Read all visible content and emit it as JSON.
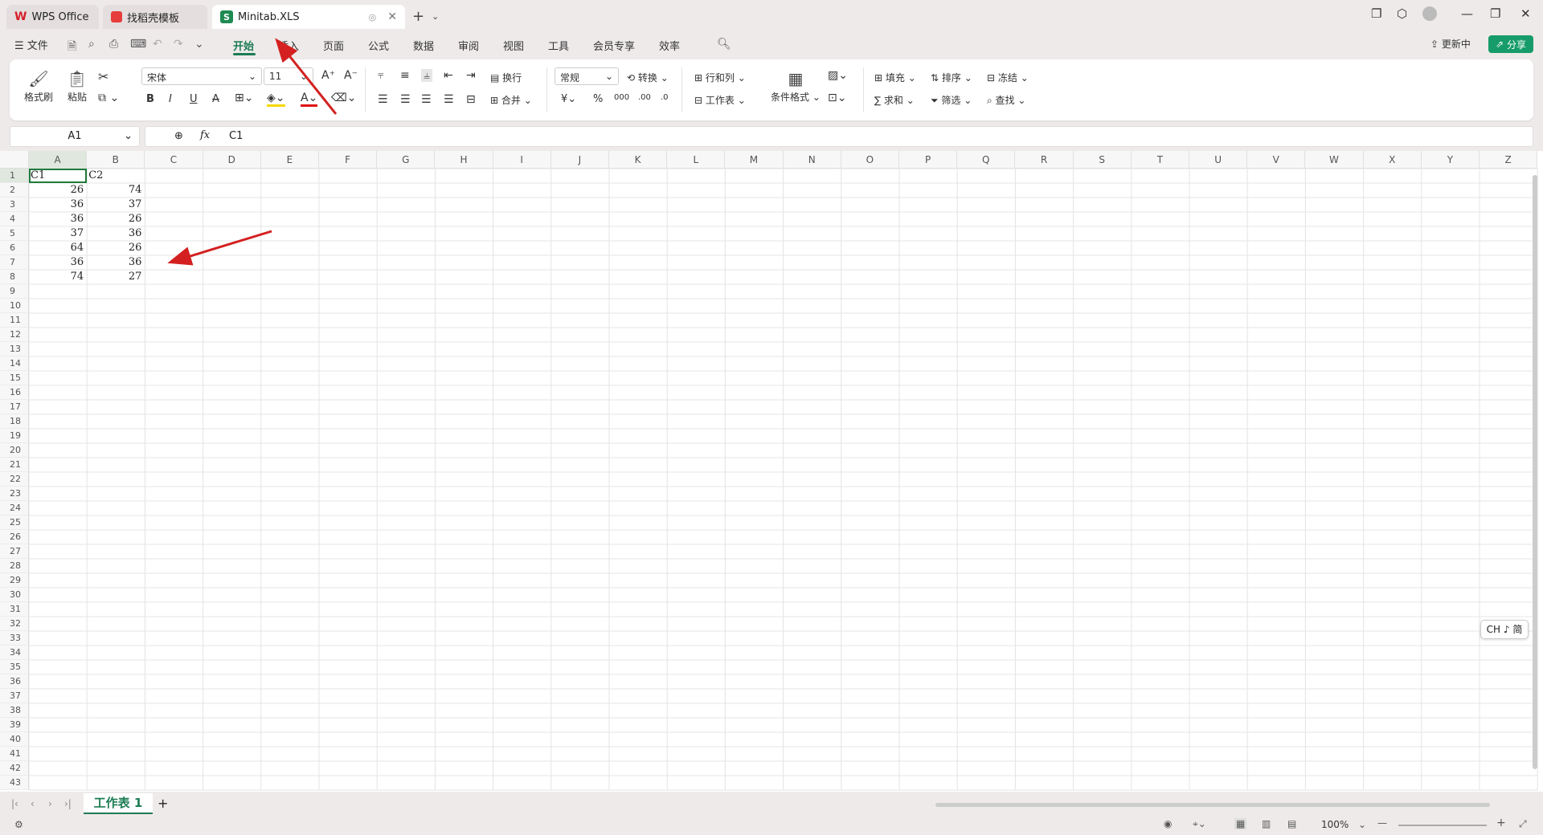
{
  "tabs": [
    {
      "label": "WPS Office"
    },
    {
      "label": "找稻壳模板"
    },
    {
      "label": "Minitab.XLS"
    }
  ],
  "menu": {
    "file": "文件",
    "items": [
      "开始",
      "插入",
      "页面",
      "公式",
      "数据",
      "审阅",
      "视图",
      "工具",
      "会员专享",
      "效率"
    ],
    "update": "更新中",
    "share": "分享"
  },
  "ribbon": {
    "format_painter": "格式刷",
    "paste": "粘贴",
    "font_name": "宋体",
    "font_size": "11",
    "wrap": "换行",
    "merge": "合并",
    "number_format": "常规",
    "convert": "转换",
    "rows_cols": "行和列",
    "worksheet": "工作表",
    "conditional": "条件格式",
    "fill": "填充",
    "sort": "排序",
    "freeze": "冻结",
    "sum": "求和",
    "filter": "筛选",
    "find": "查找"
  },
  "formula_bar": {
    "name_box": "A1",
    "fx": "fx",
    "content": "C1"
  },
  "columns": [
    "A",
    "B",
    "C",
    "D",
    "E",
    "F",
    "G",
    "H",
    "I",
    "J",
    "K",
    "L",
    "M",
    "N",
    "O",
    "P",
    "Q",
    "R",
    "S",
    "T",
    "U",
    "V",
    "W",
    "X",
    "Y",
    "Z"
  ],
  "row_count": 43,
  "cells": {
    "A": [
      "C1",
      "26",
      "36",
      "36",
      "37",
      "64",
      "36",
      "74"
    ],
    "B": [
      "C2",
      "74",
      "37",
      "26",
      "36",
      "26",
      "36",
      "27"
    ]
  },
  "ime": "CH ♪ 简",
  "sheet_tab": "工作表 1",
  "status": {
    "zoom": "100%"
  },
  "colors": {
    "accent": "#1c7c54",
    "arrow": "#d42020"
  }
}
